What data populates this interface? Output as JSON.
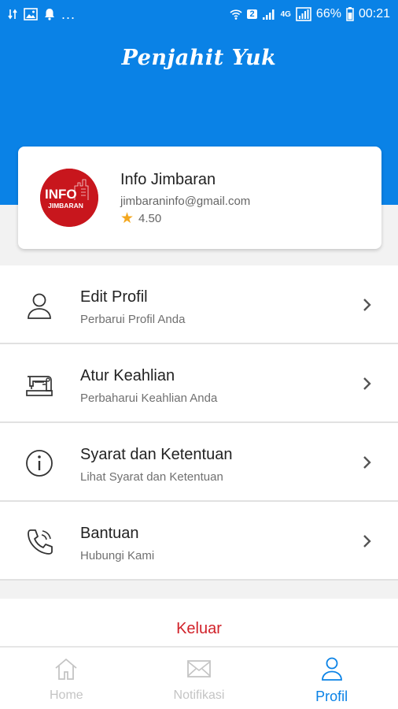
{
  "status_bar": {
    "battery": "66%",
    "time": "00:21",
    "sim": "2",
    "network": "4G"
  },
  "header": {
    "app_title": "Penjahit Yuk",
    "color": "#0a82e6"
  },
  "profile": {
    "name": "Info Jimbaran",
    "email": "jimbaraninfo@gmail.com",
    "rating": "4.50",
    "avatar_icon": "info-jimbaran-logo",
    "avatar_text_top": "INFO",
    "avatar_text_bottom": "JIMBARAN"
  },
  "menu": {
    "items": [
      {
        "title": "Edit Profil",
        "subtitle": "Perbarui Profil Anda",
        "icon": "user-icon"
      },
      {
        "title": "Atur Keahlian",
        "subtitle": "Perbaharui Keahlian Anda",
        "icon": "sewing-machine-icon"
      },
      {
        "title": "Syarat dan Ketentuan",
        "subtitle": "Lihat Syarat dan Ketentuan",
        "icon": "info-icon"
      },
      {
        "title": "Bantuan",
        "subtitle": "Hubungi Kami",
        "icon": "phone-icon"
      }
    ]
  },
  "logout_label": "Keluar",
  "bottom_nav": {
    "items": [
      {
        "label": "Home",
        "icon": "home-icon",
        "active": false
      },
      {
        "label": "Notifikasi",
        "icon": "mail-icon",
        "active": false
      },
      {
        "label": "Profil",
        "icon": "user-icon",
        "active": true
      }
    ]
  },
  "colors": {
    "accent": "#0a82e6",
    "logout": "#d1222a",
    "star": "#f3a71f"
  }
}
